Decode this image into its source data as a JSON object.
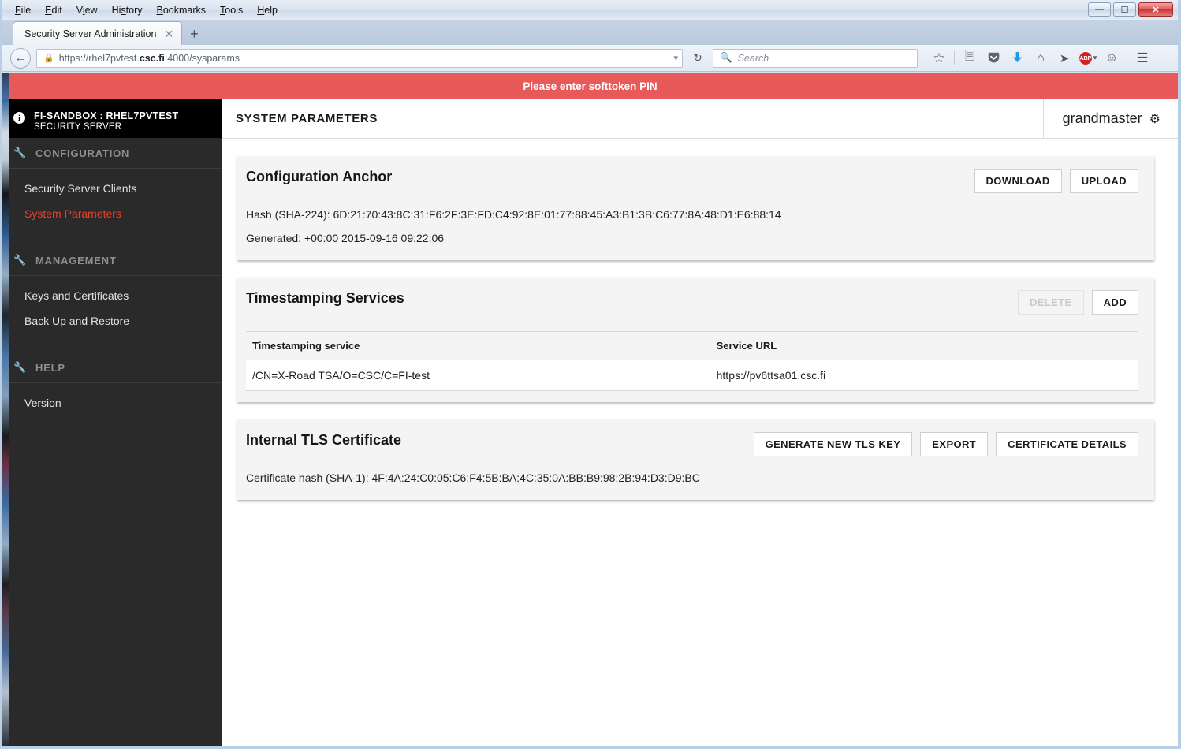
{
  "browser": {
    "menus": [
      "File",
      "Edit",
      "View",
      "History",
      "Bookmarks",
      "Tools",
      "Help"
    ],
    "window_buttons": {
      "minimize": "–",
      "maximize": "❐",
      "close": "✕"
    },
    "tab": {
      "title": "Security Server Administration",
      "close": "✕",
      "new_tab": "+"
    },
    "url": {
      "scheme": "https://rhel7pvtest.",
      "domain": "csc.fi",
      "rest": ":4000/sysparams",
      "full": "https://rhel7pvtest.csc.fi:4000/sysparams"
    },
    "search_placeholder": "Search",
    "icons": [
      "back-icon",
      "lock-icon",
      "dropdown-icon",
      "reload-icon",
      "search-icon",
      "bookmark-star-icon",
      "reader-list-icon",
      "pocket-icon",
      "downloads-icon",
      "home-icon",
      "send-tab-icon",
      "adblock-plus-icon",
      "chat-icon",
      "hamburger-menu-icon"
    ],
    "adblock_label": "ABP"
  },
  "notice": {
    "text": "Please enter softtoken PIN"
  },
  "sidebar": {
    "header": {
      "line1": "FI-SANDBOX : RHEL7PVTEST",
      "line2": "SECURITY SERVER",
      "icon": "info-icon"
    },
    "sections": [
      {
        "label": "CONFIGURATION",
        "items": [
          {
            "label": "Security Server Clients",
            "active": false
          },
          {
            "label": "System Parameters",
            "active": true
          }
        ]
      },
      {
        "label": "MANAGEMENT",
        "items": [
          {
            "label": "Keys and Certificates",
            "active": false
          },
          {
            "label": "Back Up and Restore",
            "active": false
          }
        ]
      },
      {
        "label": "HELP",
        "items": [
          {
            "label": "Version",
            "active": false
          }
        ]
      }
    ]
  },
  "header": {
    "page_title": "SYSTEM PARAMETERS",
    "username": "grandmaster",
    "gear_icon": "gear-icon"
  },
  "panels": {
    "anchor": {
      "title": "Configuration Anchor",
      "buttons": {
        "download": "DOWNLOAD",
        "upload": "UPLOAD"
      },
      "hash_label": "Hash (SHA-224): 6D:21:70:43:8C:31:F6:2F:3E:FD:C4:92:8E:01:77:88:45:A3:B1:3B:C6:77:8A:48:D1:E6:88:14",
      "generated_label": "Generated: +00:00 2015-09-16 09:22:06"
    },
    "timestamping": {
      "title": "Timestamping Services",
      "buttons": {
        "delete": "DELETE",
        "add": "ADD"
      },
      "columns": [
        "Timestamping service",
        "Service URL"
      ],
      "rows": [
        {
          "service": "/CN=X-Road TSA/O=CSC/C=FI-test",
          "url": "https://pv6ttsa01.csc.fi"
        }
      ]
    },
    "tls": {
      "title": "Internal TLS Certificate",
      "buttons": {
        "generate": "GENERATE NEW TLS KEY",
        "export": "EXPORT",
        "details": "CERTIFICATE DETAILS"
      },
      "hash_label": "Certificate hash (SHA-1): 4F:4A:24:C0:05:C6:F4:5B:BA:4C:35:0A:BB:B9:98:2B:94:D3:D9:BC"
    }
  },
  "colors": {
    "accent_red": "#e8402e",
    "notice_red": "#e85a5a",
    "sidebar_bg": "#2a2a2a",
    "sidebar_header_bg": "#000000",
    "panel_bg": "#f4f4f4"
  }
}
